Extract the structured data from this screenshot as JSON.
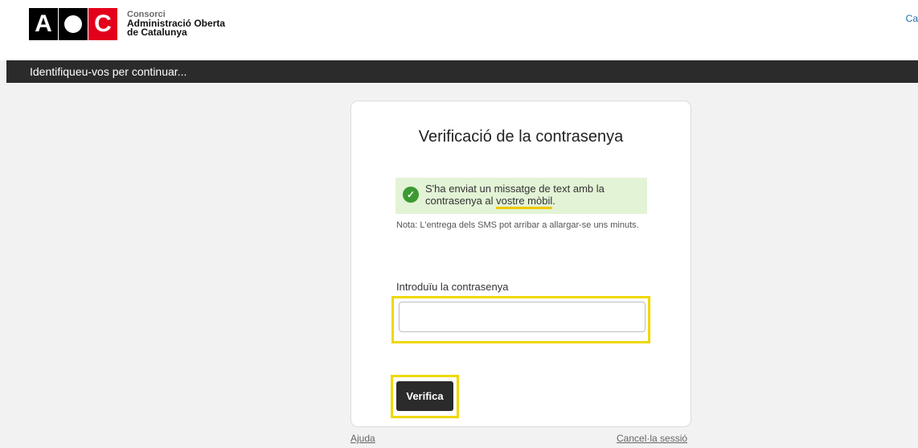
{
  "brand": {
    "logo_letters": [
      "A",
      "O",
      "C"
    ],
    "org_line1": "Consorci",
    "org_line2": "Administració Oberta",
    "org_line3": "de Catalunya",
    "accent_red": "#e3001b"
  },
  "header": {
    "lang_link": "Ca"
  },
  "topbar": {
    "text": "Identifiqueu-vos per continuar..."
  },
  "card": {
    "title": "Verificació de la contrasenya",
    "alert": {
      "text_before": "S'ha enviat un missatge de text amb la contrasenya al ",
      "link_text": "vostre mòbil",
      "text_after": ".",
      "status_color": "#3c9a32",
      "icon": "check-circle-icon"
    },
    "note": "Nota: L'entrega dels SMS pot arribar a allargar-se uns minuts.",
    "password_label": "Introduïu la contrasenya",
    "password_value": "",
    "submit_label": "Verifica",
    "highlight_color": "#f0d800"
  },
  "footer": {
    "help": "Ajuda",
    "cancel": "Cancel·la sessió"
  }
}
